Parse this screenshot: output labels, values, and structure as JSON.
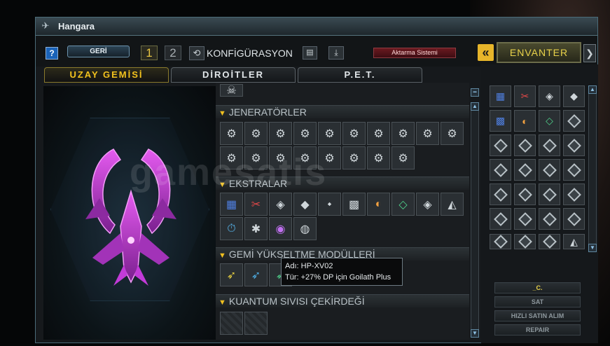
{
  "window": {
    "title": "Hangara"
  },
  "toolbar": {
    "help_label": "?",
    "back_label": "GERİ",
    "config_1": "1",
    "config_2": "2",
    "config_label": "KONFİGÜRASYON",
    "transfer_label": "Aktarma Sistemi",
    "inventory_label": "ENVANTER",
    "inventory_prev": "«",
    "inventory_next": "❯"
  },
  "tabs": [
    {
      "label": "UZAY GEMİSİ",
      "active": true
    },
    {
      "label": "DİROİTLER",
      "active": false
    },
    {
      "label": "P.E.T.",
      "active": false
    }
  ],
  "sections": {
    "generators": "JENERATÖRLER",
    "extras": "EKSTRALAR",
    "upgrade_modules": "GEMİ YÜKSELTME MODÜLLERİ",
    "quantum": "KUANTUM SIVISI ÇEKİRDEĞİ"
  },
  "tooltip": {
    "line1": "Adı: HP-XV02",
    "line2": "Tür: +27% DP için Goilath Plus"
  },
  "right_buttons": {
    "c_label": "_C.",
    "sell_label": "SAT",
    "quick_buy_label": "HIZLI SATIN ALIM",
    "repair_label": "REPAIR"
  },
  "watermark": "gamesatis",
  "colors": {
    "accent": "#f2c21e",
    "ship": "#c23bd8",
    "panel": "#1a1d20",
    "transfer_red": "#6a1a20"
  }
}
